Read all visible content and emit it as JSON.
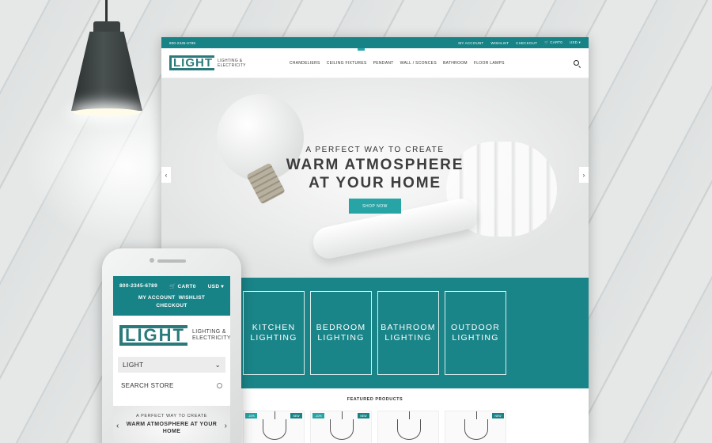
{
  "site": {
    "topbar": {
      "phone": "800-2345-6789",
      "my_account": "MY ACCOUNT",
      "wishlist": "WISHLIST",
      "checkout": "CHECKOUT",
      "cart": "CART0",
      "currency": "USD"
    },
    "logo": {
      "mark": "LIGHT",
      "tagline_1": "LIGHTING &",
      "tagline_2": "ELECTRICITY"
    },
    "nav": [
      "CHANDELIERS",
      "CEILING FIXTURES",
      "PENDANT",
      "WALL / SCONCES",
      "BATHROOM",
      "FLOOR LAMPS"
    ],
    "hero": {
      "subtitle": "A PERFECT WAY TO CREATE",
      "title_1": "WARM ATMOSPHERE",
      "title_2": "AT YOUR HOME",
      "button": "SHOP NOW"
    },
    "categories": [
      {
        "line1": "KITCHEN",
        "line2": "LIGHTING"
      },
      {
        "line1": "BEDROOM",
        "line2": "LIGHTING"
      },
      {
        "line1": "BATHROOM",
        "line2": "LIGHTING"
      },
      {
        "line1": "OUTDOOR",
        "line2": "LIGHTING"
      }
    ],
    "featured_title": "FEATURED PRODUCTS",
    "product_badges": {
      "sale": "-10%",
      "new": "NEW"
    }
  },
  "mobile": {
    "phone": "800-2345-6789",
    "cart": "CART0",
    "currency": "USD",
    "my_account": "MY ACCOUNT",
    "wishlist": "WISHLIST",
    "checkout": "CHECKOUT",
    "logo": {
      "mark": "LIGHT",
      "tagline_1": "LIGHTING &",
      "tagline_2": "ELECTRICITY"
    },
    "select_value": "LIGHT",
    "search_placeholder": "SEARCH STORE",
    "hero_subtitle": "A PERFECT WAY TO CREATE",
    "hero_title_1": "WARM ATMOSPHERE AT YOUR",
    "hero_title_2": "HOME"
  },
  "colors": {
    "teal": "#178387",
    "accent": "#26a4a6"
  }
}
